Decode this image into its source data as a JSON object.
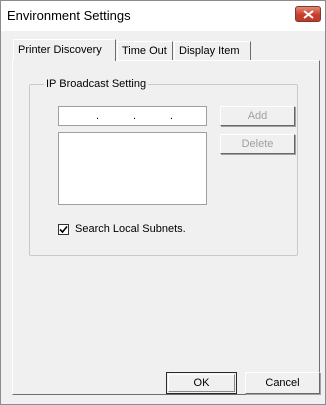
{
  "window": {
    "title": "Environment Settings"
  },
  "tabs": [
    {
      "label": "Printer Discovery",
      "active": true
    },
    {
      "label": "Time Out",
      "active": false
    },
    {
      "label": "Display Item",
      "active": false
    }
  ],
  "ip_broadcast": {
    "group_label": "IP Broadcast Setting",
    "ip_address_dots": [
      ".",
      ".",
      "."
    ],
    "add_label": "Add",
    "delete_label": "Delete",
    "list_items": []
  },
  "search_local_subnets": {
    "label": "Search Local Subnets.",
    "checked": true
  },
  "footer": {
    "ok_label": "OK",
    "cancel_label": "Cancel"
  },
  "icons": {
    "close": "close-icon",
    "check": "checkmark-icon"
  },
  "colors": {
    "close_button": "#c4402a",
    "disabled_text": "#a0a0a0"
  }
}
